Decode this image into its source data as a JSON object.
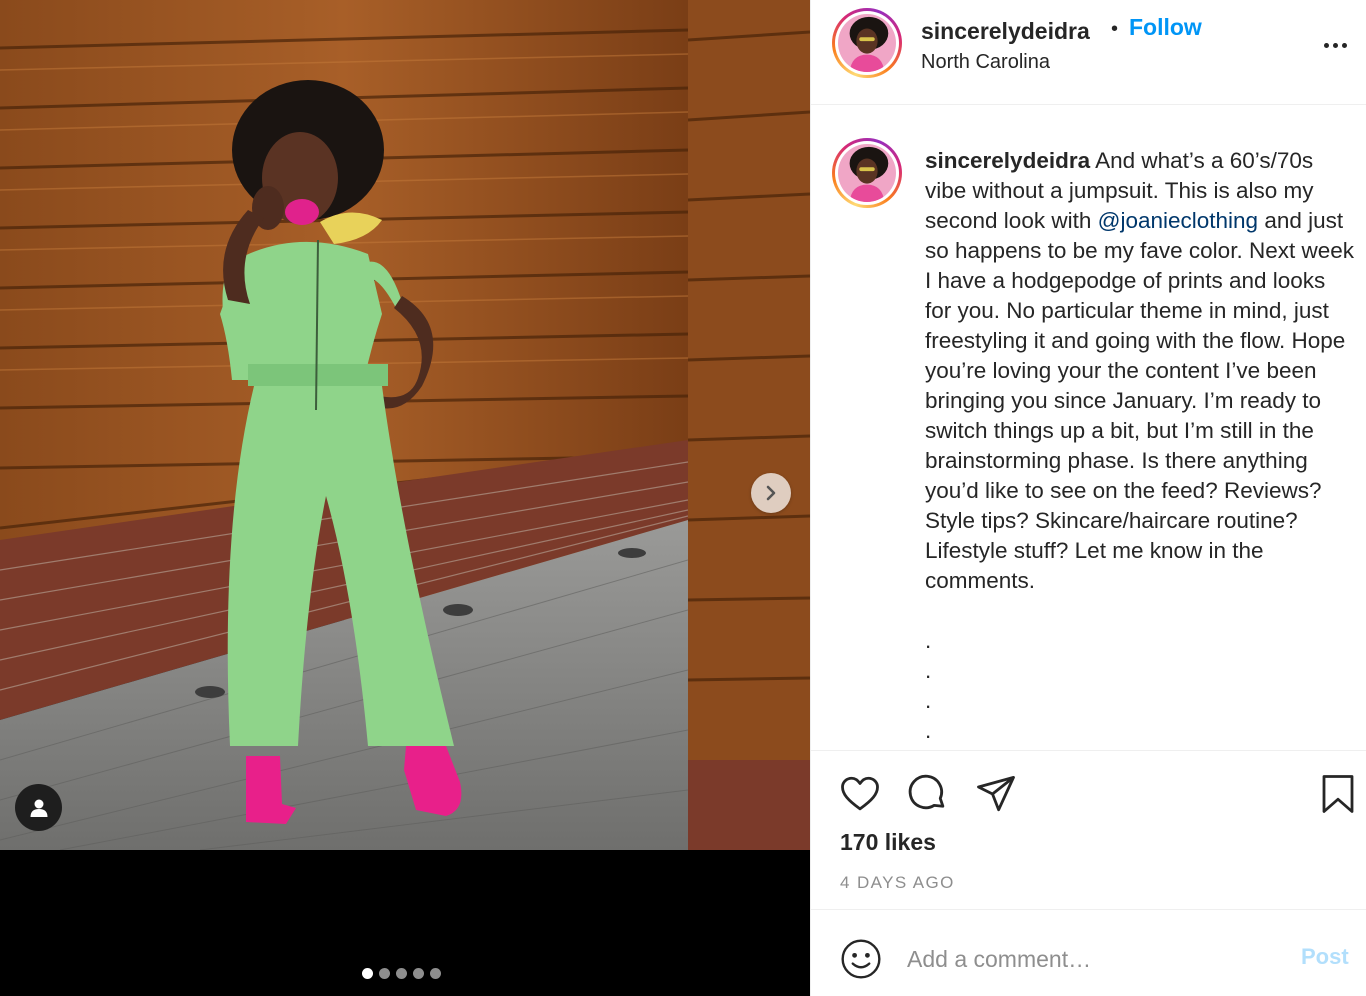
{
  "post": {
    "username": "sincerelydeidra",
    "separator": "•",
    "follow_label": "Follow",
    "location": "North Carolina"
  },
  "caption": {
    "username": "sincerelydeidra",
    "text_before_mention": " And what’s a 60’s/70s vibe without a jumpsuit. This is also my second look with ",
    "mention": "@joanieclothing",
    "text_after_mention": " and just so happens to be my fave color. Next week I have a hodgepodge of prints and looks for you. No particular theme in mind, just freestyling it and going with the flow. Hope you’re loving your the content I’ve been bringing you since January. I’m ready to switch things up a bit, but I’m still in the brainstorming phase. Is there anything you’d like to see on the feed? Reviews? Style tips? Skincare/haircare routine? Lifestyle stuff? Let me know in the comments.",
    "trailing_dots": ".\n.\n.\n."
  },
  "stats": {
    "likes": "170 likes",
    "time_ago": "4 DAYS AGO"
  },
  "comment": {
    "placeholder": "Add a comment…",
    "post_label": "Post"
  },
  "carousel": {
    "slide_count": 5,
    "active_index": 0
  },
  "icons": {
    "like": "heart-icon",
    "comment": "comment-bubble-icon",
    "share": "paper-plane-icon",
    "save": "bookmark-icon",
    "more": "more-options-icon",
    "next": "chevron-right-icon",
    "tag": "user-tag-icon",
    "emoji": "emoji-icon"
  },
  "colors": {
    "accent": "#0095f6",
    "mention": "#00376b",
    "muted": "#8e8e8e",
    "post_disabled": "#b2dffc"
  }
}
